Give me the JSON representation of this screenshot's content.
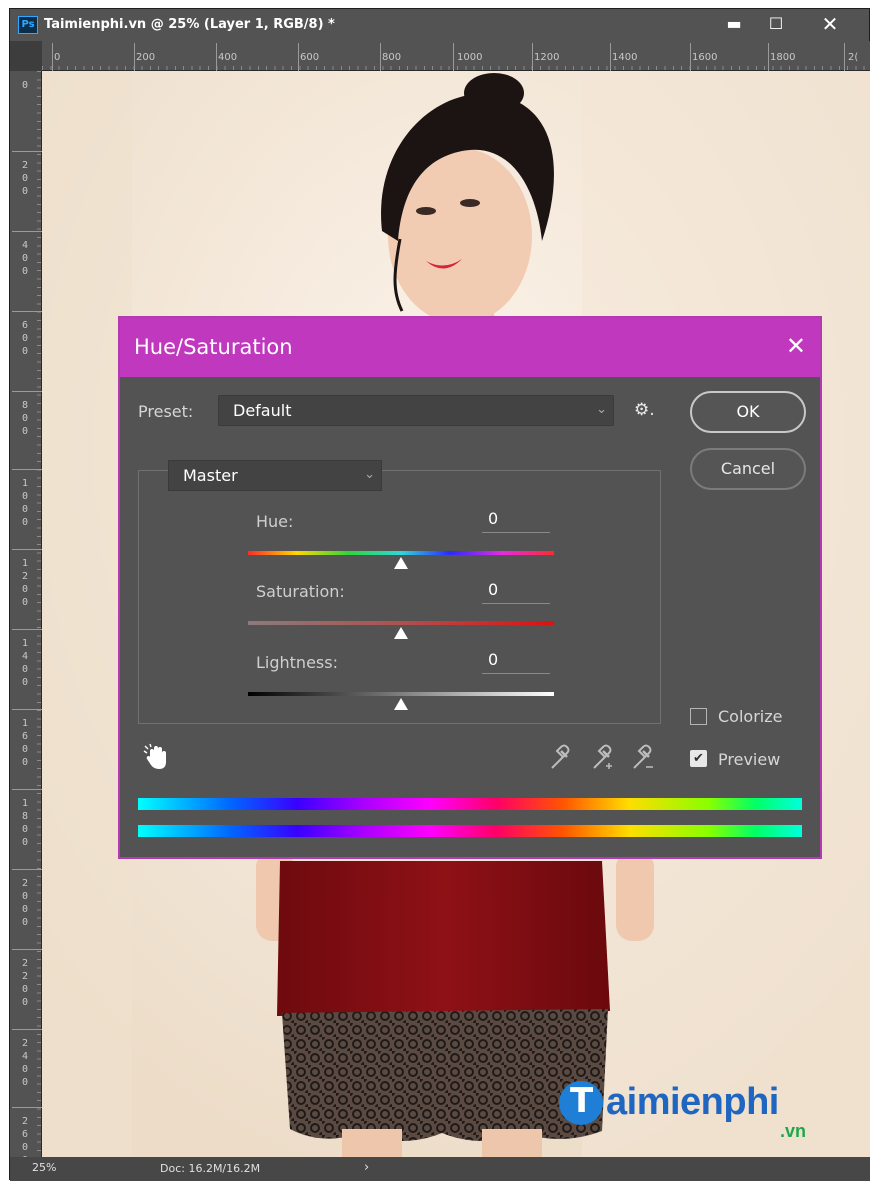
{
  "window": {
    "app_icon": "Ps",
    "title": "Taimienphi.vn @ 25% (Layer 1, RGB/8) *",
    "minimize_icon": "minimize-icon",
    "maximize_icon": "maximize-icon",
    "close_icon": "close-icon"
  },
  "ruler_top": {
    "labels": [
      "0",
      "200",
      "400",
      "600",
      "800",
      "1000",
      "1200",
      "1400",
      "1600",
      "1800",
      "2("
    ]
  },
  "ruler_left": {
    "labels": [
      "0",
      "2\n0\n0",
      "4\n0\n0",
      "6\n0\n0",
      "8\n0\n0",
      "1\n0\n0\n0",
      "1\n2\n0\n0",
      "1\n4\n0\n0",
      "1\n6\n0\n0",
      "1\n8\n0\n0",
      "2\n0\n0\n0",
      "2\n2\n0\n0",
      "2\n4\n0\n0",
      "2\n6\n0\n0"
    ]
  },
  "status_bar": {
    "zoom": "25%",
    "doc_size": "Doc: 16.2M/16.2M",
    "arrow": "›"
  },
  "watermark": {
    "logo_letter": "T",
    "name": "aimienphi",
    "domain": ".vn"
  },
  "dialog": {
    "title": "Hue/Saturation",
    "close": "✕",
    "preset_label": "Preset:",
    "preset_value": "Default",
    "preset_chevron": "⌄",
    "gear": "⚙.",
    "ok_label": "OK",
    "cancel_label": "Cancel",
    "channel_value": "Master",
    "channel_chevron": "⌄",
    "hue_label": "Hue:",
    "hue_value": "0",
    "saturation_label": "Saturation:",
    "saturation_value": "0",
    "lightness_label": "Lightness:",
    "lightness_value": "0",
    "hue_slider": 0.5,
    "saturation_slider": 0.5,
    "lightness_slider": 0.5,
    "colorize_label": "Colorize",
    "colorize_checked": false,
    "preview_label": "Preview",
    "preview_checked": true,
    "preview_check": "✔",
    "accent_color": "#bf38bd"
  }
}
